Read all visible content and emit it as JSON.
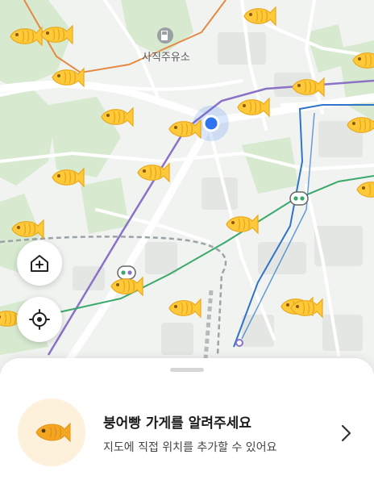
{
  "map": {
    "poi_label": "사직주유소",
    "poi_icon": "gas-station-icon",
    "colors": {
      "marker": "#ffc93a",
      "user_dot": "#2e73f0",
      "route_purple": "#8a72c6",
      "route_green": "#3aa86b",
      "route_blue": "#2f74c9",
      "route_orange": "#e58a45"
    },
    "marker_count": 25
  },
  "controls": {
    "home_add_icon": "home-plus-icon",
    "locate_icon": "crosshair-locate-icon"
  },
  "sheet": {
    "card": {
      "title": "붕어빵 가게를 알려주세요",
      "subtitle": "지도에 직접 위치를 추가할 수 있어요",
      "icon": "fish-bread-icon"
    }
  }
}
